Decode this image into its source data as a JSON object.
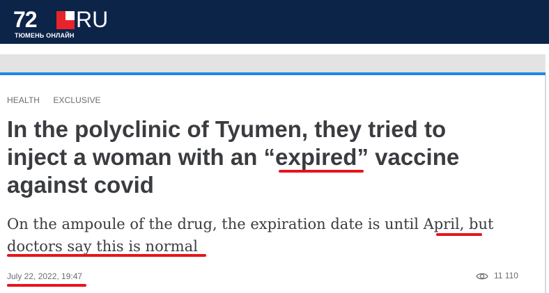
{
  "header": {
    "logo_number": "72",
    "logo_suffix": "RU",
    "logo_tagline": "ТЮМЕНЬ ОНЛАЙН",
    "logo_mark_colors": [
      "#e8232b",
      "#ffffff"
    ]
  },
  "article": {
    "tags": [
      "HEALTH",
      "EXCLUSIVE"
    ],
    "title": "In the polyclinic of Tyumen, they tried to inject a woman with an “expired” vaccine against covid",
    "subtitle": "On the ampoule of the drug, the expiration date is until April, but doctors say this is normal",
    "date": "July 22, 2022, 19:47",
    "views": "11 110",
    "views_icon": "eye-icon"
  },
  "colors": {
    "header_bg": "#0d2449",
    "accent_blue": "#1e88e5",
    "annotation_red": "#e8141c",
    "text": "#3a3c40"
  }
}
